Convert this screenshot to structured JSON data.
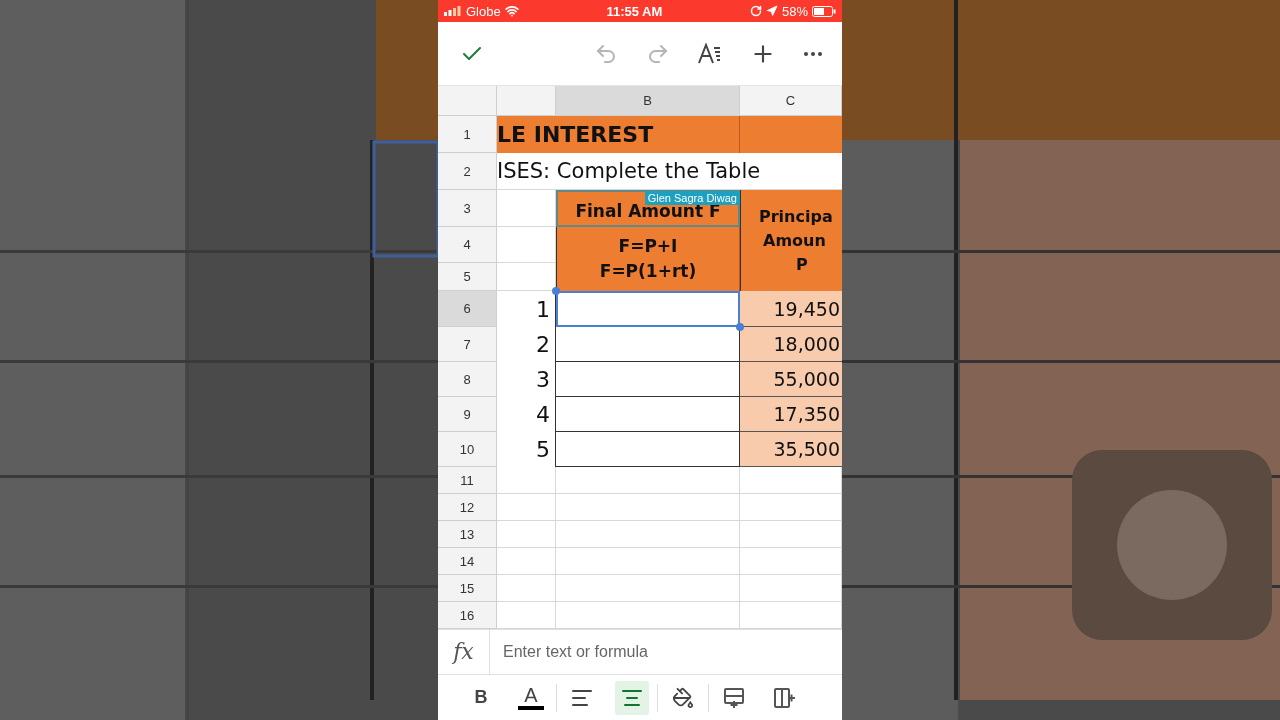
{
  "status_bar": {
    "carrier": "Globe",
    "time": "11:55 AM",
    "battery": "58%"
  },
  "toolbar": {
    "undo": {
      "disabled": true
    },
    "redo": {
      "disabled": true
    }
  },
  "sheet": {
    "columns": [
      {
        "label": "B",
        "selected": true
      },
      {
        "label": "C",
        "selected": false
      }
    ],
    "row_numbers": [
      "1",
      "2",
      "3",
      "4",
      "5",
      "6",
      "7",
      "8",
      "9",
      "10",
      "11",
      "12",
      "13",
      "14",
      "15",
      "16"
    ],
    "title": "LE INTEREST",
    "subtitle": "ISES: Complete the Table",
    "final_header": "Final Amount F",
    "formula_lines": [
      "F=P+I",
      "F=P(1+rt)"
    ],
    "principal_header_lines": [
      "Principa",
      "Amoun",
      "P"
    ],
    "collaborator_tag": "Glen Sagra Diwag",
    "rows": [
      {
        "number": "1",
        "principal": "19,450",
        "selected": true
      },
      {
        "number": "2",
        "principal": "18,000",
        "selected": false
      },
      {
        "number": "3",
        "principal": "55,000",
        "selected": false
      },
      {
        "number": "4",
        "principal": "17,350",
        "selected": false
      },
      {
        "number": "5",
        "principal": "35,500",
        "selected": false
      }
    ]
  },
  "formula_bar": {
    "label": "fx",
    "placeholder": "Enter text or formula"
  },
  "format_bar": [
    {
      "kind": "bold",
      "label": "B",
      "selected": false
    },
    {
      "kind": "text-color",
      "label": "A",
      "selected": false
    },
    {
      "kind": "align-left",
      "selected": false
    },
    {
      "kind": "align-center",
      "selected": true
    },
    {
      "kind": "fill-color",
      "selected": false
    },
    {
      "kind": "insert-row",
      "selected": false
    },
    {
      "kind": "insert-column",
      "selected": false
    }
  ]
}
